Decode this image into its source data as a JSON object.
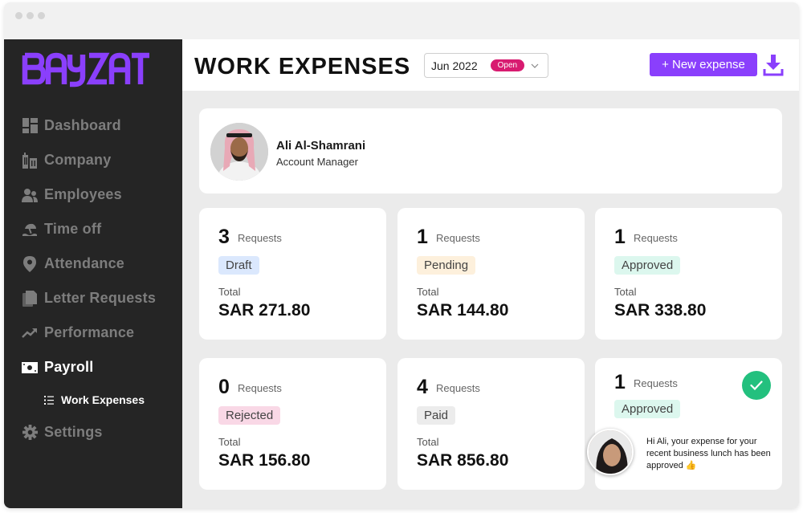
{
  "app": {
    "brand": "BAYZAT",
    "brand_color": "#8a3ffc"
  },
  "sidebar": {
    "items": [
      {
        "label": "Dashboard",
        "icon": "dashboard-icon",
        "active": false
      },
      {
        "label": "Company",
        "icon": "company-buildings-icon",
        "active": false
      },
      {
        "label": "Employees",
        "icon": "employees-icon",
        "active": false
      },
      {
        "label": "Time off",
        "icon": "beach-umbrella-icon",
        "active": false
      },
      {
        "label": "Attendance",
        "icon": "location-pin-icon",
        "active": false
      },
      {
        "label": "Letter Requests",
        "icon": "documents-icon",
        "active": false
      },
      {
        "label": "Performance",
        "icon": "trending-up-icon",
        "active": false
      },
      {
        "label": "Payroll",
        "icon": "money-bill-icon",
        "active": true
      },
      {
        "label": "Settings",
        "icon": "gear-icon",
        "active": false
      }
    ],
    "subitem": {
      "label": "Work Expenses",
      "icon": "list-icon"
    }
  },
  "header": {
    "title": "WORK EXPENSES",
    "period": {
      "value": "Jun 2022",
      "badge": "Open",
      "badge_color": "#d81b70"
    },
    "new_button": "+ New expense",
    "download_icon": "download-icon"
  },
  "profile": {
    "name": "Ali Al-Shamrani",
    "role": "Account Manager"
  },
  "stats": [
    {
      "count": "3",
      "requests_label": "Requests",
      "status": "Draft",
      "total_label": "Total",
      "total": "SAR 271.80",
      "status_color": "#dbe8fd"
    },
    {
      "count": "1",
      "requests_label": "Requests",
      "status": "Pending",
      "total_label": "Total",
      "total": "SAR 144.80",
      "status_color": "#fdf0dc"
    },
    {
      "count": "1",
      "requests_label": "Requests",
      "status": "Approved",
      "total_label": "Total",
      "total": "SAR 338.80",
      "status_color": "#dcf7ee"
    },
    {
      "count": "0",
      "requests_label": "Requests",
      "status": "Rejected",
      "total_label": "Total",
      "total": "SAR 156.80",
      "status_color": "#f9d8e6"
    },
    {
      "count": "4",
      "requests_label": "Requests",
      "status": "Paid",
      "total_label": "Total",
      "total": "SAR 856.80",
      "status_color": "#ececec"
    }
  ],
  "notification": {
    "count": "1",
    "requests_label": "Requests",
    "status": "Approved",
    "check_color": "#23c07e",
    "message": "Hi Ali, your expense for your recent business lunch has been approved 👍"
  }
}
